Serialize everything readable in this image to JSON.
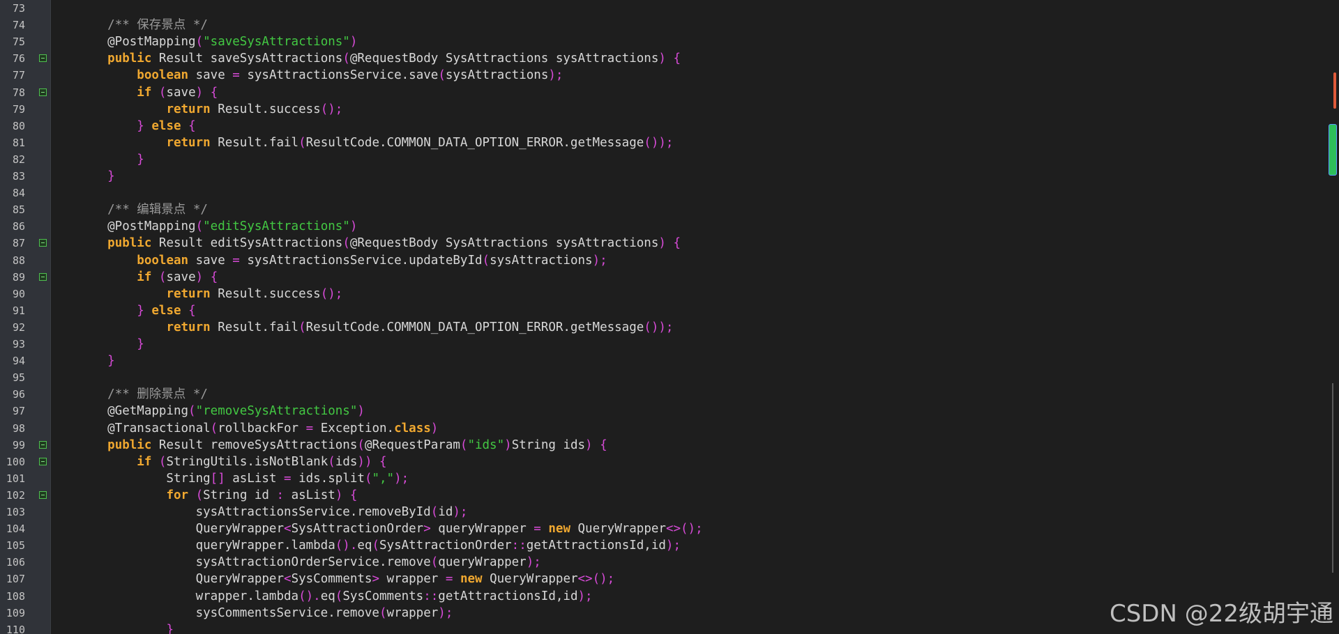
{
  "editor": {
    "watermark": "CSDN @22级胡宇通",
    "lines": [
      {
        "n": "73",
        "fold": false,
        "tokens": []
      },
      {
        "n": "74",
        "fold": false,
        "tokens": [
          [
            "    ",
            "id"
          ],
          [
            "/** 保存景点 */",
            "com"
          ]
        ]
      },
      {
        "n": "75",
        "fold": false,
        "tokens": [
          [
            "    @PostMapping",
            "ann"
          ],
          [
            "(",
            "pn"
          ],
          [
            "\"saveSysAttractions\"",
            "str"
          ],
          [
            ")",
            "pn"
          ]
        ]
      },
      {
        "n": "76",
        "fold": true,
        "tokens": [
          [
            "    ",
            "id"
          ],
          [
            "public",
            "kw"
          ],
          [
            " Result saveSysAttractions",
            "id"
          ],
          [
            "(",
            "pn"
          ],
          [
            "@RequestBody SysAttractions sysAttractions",
            "id"
          ],
          [
            ")",
            "pn"
          ],
          [
            " ",
            "id"
          ],
          [
            "{",
            "pn"
          ]
        ]
      },
      {
        "n": "77",
        "fold": false,
        "tokens": [
          [
            "        ",
            "id"
          ],
          [
            "boolean",
            "kw"
          ],
          [
            " save ",
            "id"
          ],
          [
            "=",
            "pn"
          ],
          [
            " sysAttractionsService.save",
            "id"
          ],
          [
            "(",
            "pn"
          ],
          [
            "sysAttractions",
            "id"
          ],
          [
            ");",
            "pn"
          ]
        ]
      },
      {
        "n": "78",
        "fold": true,
        "tokens": [
          [
            "        ",
            "id"
          ],
          [
            "if",
            "kw"
          ],
          [
            " ",
            "id"
          ],
          [
            "(",
            "pn"
          ],
          [
            "save",
            "id"
          ],
          [
            ")",
            "pn"
          ],
          [
            " ",
            "id"
          ],
          [
            "{",
            "pn"
          ]
        ]
      },
      {
        "n": "79",
        "fold": false,
        "tokens": [
          [
            "            ",
            "id"
          ],
          [
            "return",
            "kw"
          ],
          [
            " Result.success",
            "id"
          ],
          [
            "();",
            "pn"
          ]
        ]
      },
      {
        "n": "80",
        "fold": false,
        "tokens": [
          [
            "        ",
            "id"
          ],
          [
            "}",
            "pn"
          ],
          [
            " ",
            "id"
          ],
          [
            "else",
            "kw"
          ],
          [
            " ",
            "id"
          ],
          [
            "{",
            "pn"
          ]
        ]
      },
      {
        "n": "81",
        "fold": false,
        "tokens": [
          [
            "            ",
            "id"
          ],
          [
            "return",
            "kw"
          ],
          [
            " Result.fail",
            "id"
          ],
          [
            "(",
            "pn"
          ],
          [
            "ResultCode.COMMON_DATA_OPTION_ERROR.getMessage",
            "id"
          ],
          [
            "());",
            "pn"
          ]
        ]
      },
      {
        "n": "82",
        "fold": false,
        "tokens": [
          [
            "        ",
            "id"
          ],
          [
            "}",
            "pn"
          ]
        ]
      },
      {
        "n": "83",
        "fold": false,
        "tokens": [
          [
            "    ",
            "id"
          ],
          [
            "}",
            "pn"
          ]
        ]
      },
      {
        "n": "84",
        "fold": false,
        "tokens": []
      },
      {
        "n": "85",
        "fold": false,
        "tokens": [
          [
            "    ",
            "id"
          ],
          [
            "/** 编辑景点 */",
            "com"
          ]
        ]
      },
      {
        "n": "86",
        "fold": false,
        "tokens": [
          [
            "    @PostMapping",
            "ann"
          ],
          [
            "(",
            "pn"
          ],
          [
            "\"editSysAttractions\"",
            "str"
          ],
          [
            ")",
            "pn"
          ]
        ]
      },
      {
        "n": "87",
        "fold": true,
        "tokens": [
          [
            "    ",
            "id"
          ],
          [
            "public",
            "kw"
          ],
          [
            " Result editSysAttractions",
            "id"
          ],
          [
            "(",
            "pn"
          ],
          [
            "@RequestBody SysAttractions sysAttractions",
            "id"
          ],
          [
            ")",
            "pn"
          ],
          [
            " ",
            "id"
          ],
          [
            "{",
            "pn"
          ]
        ]
      },
      {
        "n": "88",
        "fold": false,
        "tokens": [
          [
            "        ",
            "id"
          ],
          [
            "boolean",
            "kw"
          ],
          [
            " save ",
            "id"
          ],
          [
            "=",
            "pn"
          ],
          [
            " sysAttractionsService.updateById",
            "id"
          ],
          [
            "(",
            "pn"
          ],
          [
            "sysAttractions",
            "id"
          ],
          [
            ");",
            "pn"
          ]
        ]
      },
      {
        "n": "89",
        "fold": true,
        "tokens": [
          [
            "        ",
            "id"
          ],
          [
            "if",
            "kw"
          ],
          [
            " ",
            "id"
          ],
          [
            "(",
            "pn"
          ],
          [
            "save",
            "id"
          ],
          [
            ")",
            "pn"
          ],
          [
            " ",
            "id"
          ],
          [
            "{",
            "pn"
          ]
        ]
      },
      {
        "n": "90",
        "fold": false,
        "tokens": [
          [
            "            ",
            "id"
          ],
          [
            "return",
            "kw"
          ],
          [
            " Result.success",
            "id"
          ],
          [
            "();",
            "pn"
          ]
        ]
      },
      {
        "n": "91",
        "fold": false,
        "tokens": [
          [
            "        ",
            "id"
          ],
          [
            "}",
            "pn"
          ],
          [
            " ",
            "id"
          ],
          [
            "else",
            "kw"
          ],
          [
            " ",
            "id"
          ],
          [
            "{",
            "pn"
          ]
        ]
      },
      {
        "n": "92",
        "fold": false,
        "tokens": [
          [
            "            ",
            "id"
          ],
          [
            "return",
            "kw"
          ],
          [
            " Result.fail",
            "id"
          ],
          [
            "(",
            "pn"
          ],
          [
            "ResultCode.COMMON_DATA_OPTION_ERROR.getMessage",
            "id"
          ],
          [
            "());",
            "pn"
          ]
        ]
      },
      {
        "n": "93",
        "fold": false,
        "tokens": [
          [
            "        ",
            "id"
          ],
          [
            "}",
            "pn"
          ]
        ]
      },
      {
        "n": "94",
        "fold": false,
        "tokens": [
          [
            "    ",
            "id"
          ],
          [
            "}",
            "pn"
          ]
        ]
      },
      {
        "n": "95",
        "fold": false,
        "tokens": []
      },
      {
        "n": "96",
        "fold": false,
        "tokens": [
          [
            "    ",
            "id"
          ],
          [
            "/** 删除景点 */",
            "com"
          ]
        ]
      },
      {
        "n": "97",
        "fold": false,
        "tokens": [
          [
            "    @GetMapping",
            "ann"
          ],
          [
            "(",
            "pn"
          ],
          [
            "\"removeSysAttractions\"",
            "str"
          ],
          [
            ")",
            "pn"
          ]
        ]
      },
      {
        "n": "98",
        "fold": false,
        "tokens": [
          [
            "    @Transactional",
            "ann"
          ],
          [
            "(",
            "pn"
          ],
          [
            "rollbackFor ",
            "id"
          ],
          [
            "=",
            "pn"
          ],
          [
            " Exception.",
            "id"
          ],
          [
            "class",
            "kw"
          ],
          [
            ")",
            "pn"
          ]
        ]
      },
      {
        "n": "99",
        "fold": true,
        "tokens": [
          [
            "    ",
            "id"
          ],
          [
            "public",
            "kw"
          ],
          [
            " Result removeSysAttractions",
            "id"
          ],
          [
            "(",
            "pn"
          ],
          [
            "@RequestParam",
            "id"
          ],
          [
            "(",
            "pn"
          ],
          [
            "\"ids\"",
            "str"
          ],
          [
            ")",
            "pn"
          ],
          [
            "String ids",
            "id"
          ],
          [
            ")",
            "pn"
          ],
          [
            " ",
            "id"
          ],
          [
            "{",
            "pn"
          ]
        ]
      },
      {
        "n": "100",
        "fold": true,
        "tokens": [
          [
            "        ",
            "id"
          ],
          [
            "if",
            "kw"
          ],
          [
            " ",
            "id"
          ],
          [
            "(",
            "pn"
          ],
          [
            "StringUtils.isNotBlank",
            "id"
          ],
          [
            "(",
            "pn"
          ],
          [
            "ids",
            "id"
          ],
          [
            "))",
            "pn"
          ],
          [
            " ",
            "id"
          ],
          [
            "{",
            "pn"
          ]
        ]
      },
      {
        "n": "101",
        "fold": false,
        "tokens": [
          [
            "            String",
            "id"
          ],
          [
            "[]",
            "pn"
          ],
          [
            " asList ",
            "id"
          ],
          [
            "=",
            "pn"
          ],
          [
            " ids.split",
            "id"
          ],
          [
            "(",
            "pn"
          ],
          [
            "\",\"",
            "str"
          ],
          [
            ");",
            "pn"
          ]
        ]
      },
      {
        "n": "102",
        "fold": true,
        "tokens": [
          [
            "            ",
            "id"
          ],
          [
            "for",
            "kw"
          ],
          [
            " ",
            "id"
          ],
          [
            "(",
            "pn"
          ],
          [
            "String id ",
            "id"
          ],
          [
            ":",
            "pn"
          ],
          [
            " asList",
            "id"
          ],
          [
            ")",
            "pn"
          ],
          [
            " ",
            "id"
          ],
          [
            "{",
            "pn"
          ]
        ]
      },
      {
        "n": "103",
        "fold": false,
        "tokens": [
          [
            "                sysAttractionsService.removeById",
            "id"
          ],
          [
            "(",
            "pn"
          ],
          [
            "id",
            "id"
          ],
          [
            ");",
            "pn"
          ]
        ]
      },
      {
        "n": "104",
        "fold": false,
        "tokens": [
          [
            "                QueryWrapper",
            "id"
          ],
          [
            "<",
            "pn"
          ],
          [
            "SysAttractionOrder",
            "id"
          ],
          [
            ">",
            "pn"
          ],
          [
            " queryWrapper ",
            "id"
          ],
          [
            "=",
            "pn"
          ],
          [
            " ",
            "id"
          ],
          [
            "new",
            "kw"
          ],
          [
            " QueryWrapper",
            "id"
          ],
          [
            "<>();",
            "pn"
          ]
        ]
      },
      {
        "n": "105",
        "fold": false,
        "tokens": [
          [
            "                queryWrapper.lambda",
            "id"
          ],
          [
            "().",
            "pn"
          ],
          [
            "eq",
            "id"
          ],
          [
            "(",
            "pn"
          ],
          [
            "SysAttractionOrder",
            "id"
          ],
          [
            "::",
            "pn"
          ],
          [
            "getAttractionsId,id",
            "id"
          ],
          [
            ");",
            "pn"
          ]
        ]
      },
      {
        "n": "106",
        "fold": false,
        "tokens": [
          [
            "                sysAttractionOrderService.remove",
            "id"
          ],
          [
            "(",
            "pn"
          ],
          [
            "queryWrapper",
            "id"
          ],
          [
            ");",
            "pn"
          ]
        ]
      },
      {
        "n": "107",
        "fold": false,
        "tokens": [
          [
            "                QueryWrapper",
            "id"
          ],
          [
            "<",
            "pn"
          ],
          [
            "SysComments",
            "id"
          ],
          [
            ">",
            "pn"
          ],
          [
            " wrapper ",
            "id"
          ],
          [
            "=",
            "pn"
          ],
          [
            " ",
            "id"
          ],
          [
            "new",
            "kw"
          ],
          [
            " QueryWrapper",
            "id"
          ],
          [
            "<>();",
            "pn"
          ]
        ]
      },
      {
        "n": "108",
        "fold": false,
        "tokens": [
          [
            "                wrapper.lambda",
            "id"
          ],
          [
            "().",
            "pn"
          ],
          [
            "eq",
            "id"
          ],
          [
            "(",
            "pn"
          ],
          [
            "SysComments",
            "id"
          ],
          [
            "::",
            "pn"
          ],
          [
            "getAttractionsId,id",
            "id"
          ],
          [
            ");",
            "pn"
          ]
        ]
      },
      {
        "n": "109",
        "fold": false,
        "tokens": [
          [
            "                sysCommentsService.remove",
            "id"
          ],
          [
            "(",
            "pn"
          ],
          [
            "wrapper",
            "id"
          ],
          [
            ");",
            "pn"
          ]
        ]
      },
      {
        "n": "110",
        "fold": false,
        "tokens": [
          [
            "            ",
            "id"
          ],
          [
            "}",
            "pn"
          ]
        ]
      }
    ]
  }
}
